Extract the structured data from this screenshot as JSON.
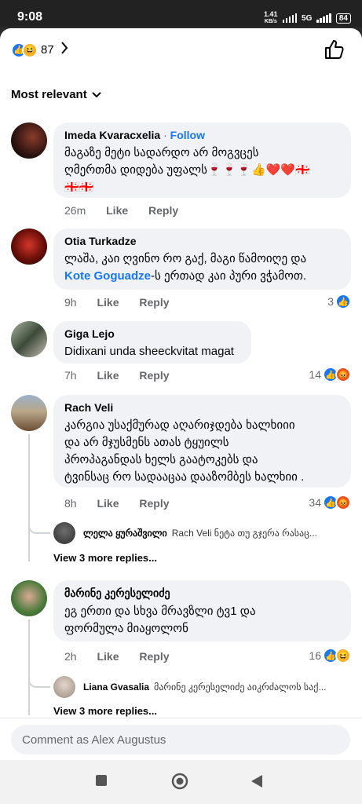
{
  "status": {
    "time": "9:08",
    "net_speed": "1.41",
    "net_unit": "KB/s",
    "network": "5G",
    "battery": "84"
  },
  "reactions": {
    "count": "87",
    "icons": [
      "like-icon",
      "haha-icon"
    ]
  },
  "sort": {
    "label": "Most relevant"
  },
  "comments": [
    {
      "author": "Imeda Kvaracxelia",
      "follow": "Follow",
      "lines": [
        "მაგაზე მეტი სადარდო არ მოგვცეს",
        "ღმერთმა  დიდება უფალს🍷🍷🍷👍❤️❤️🇬🇪",
        "🇬🇪🇬🇪"
      ],
      "time": "26m",
      "like": "Like",
      "reply": "Reply",
      "reactions": ""
    },
    {
      "author": "Otia Turkadze",
      "lines": [
        "ლაშა, კაი ღვინო რო გაქ, მაგი წამოიღე და"
      ],
      "mention": "Kote Goguadze",
      "after_mention": "-ს ერთად კაი პური ვჭამოთ.",
      "time": "9h",
      "like": "Like",
      "reply": "Reply",
      "reactions": "3"
    },
    {
      "author": "Giga Lejo",
      "lines": [
        "Didixani unda sheeckvitat magat"
      ],
      "time": "7h",
      "like": "Like",
      "reply": "Reply",
      "reactions": "14"
    },
    {
      "author": "Rach Veli",
      "lines": [
        "კარგია  უსაქმურად აღარიჯდება ხალხიიი",
        "და არ მჯუსმენს ათას ტყუილს",
        "პროპაგანდას    ხელს გაატოკებს და",
        "ტვინსაც რო სადააცაა დააზომბეს ხალხიი  ."
      ],
      "time": "8h",
      "like": "Like",
      "reply": "Reply",
      "reactions": "34",
      "reply_preview": {
        "author": "ლელა ყურაშვილი",
        "text": "Rach Veli ნეტა თუ გჯერა რასაც..."
      },
      "more_replies": "View 3 more replies..."
    },
    {
      "author": "მარინე კერესელიძე",
      "lines": [
        "ეგ ერთი და სხვა მრავზლი ტვ1 და",
        "ფორმულა მიაყოლონ"
      ],
      "time": "2h",
      "like": "Like",
      "reply": "Reply",
      "reactions": "16",
      "reply_preview": {
        "author": "Liana  Gvasalia",
        "text": "მარინე კერესელიძე აიკრძალოს საქ..."
      },
      "more_replies": "View 3 more replies..."
    }
  ],
  "composer": {
    "placeholder": "Comment as Alex Augustus"
  },
  "colors": {
    "accent": "#1877f2",
    "bubble": "#f0f2f5",
    "muted": "#65676b"
  }
}
